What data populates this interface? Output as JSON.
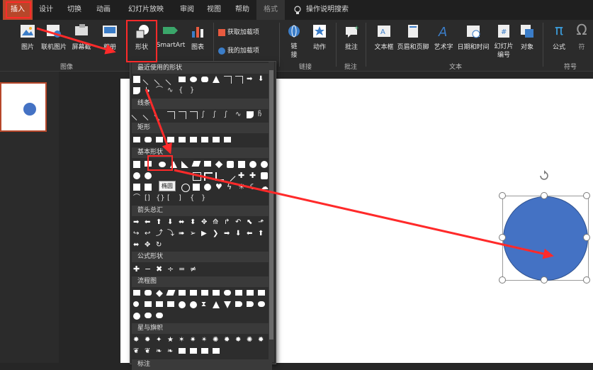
{
  "tabs": [
    "插入",
    "设计",
    "切换",
    "动画",
    "幻灯片放映",
    "审阅",
    "视图",
    "帮助",
    "格式",
    "操作说明搜索"
  ],
  "ribbon": {
    "image_btn": "图片",
    "online_image_btn": "联机图片",
    "screenshot_btn": "屏幕截",
    "album_btn": "相册",
    "shapes_btn": "形状",
    "smartart_btn": "SmartArt",
    "chart_btn": "图表",
    "get_addins": "获取加载项",
    "my_addins": "我的加载项",
    "link_btn_1": "链",
    "link_btn_2": "接",
    "action_btn": "动作",
    "comment_btn": "批注",
    "textbox_btn": "文本框",
    "headerfooter_btn": "页眉和页脚",
    "wordart_btn": "艺术字",
    "datetime_btn": "日期和时间",
    "slidenum_btn_1": "幻灯片",
    "slidenum_btn_2": "编号",
    "object_btn": "对象",
    "equation_btn": "公式",
    "symbol_btn": "符",
    "groups": {
      "image": "图像",
      "link": "链接",
      "comment": "批注",
      "text": "文本",
      "symbol": "符号"
    }
  },
  "shapes_menu": {
    "recent": "最近使用的形状",
    "lines": "线条",
    "rect": "矩形",
    "basic": "基本形状",
    "arrows": "箭头总汇",
    "equation": "公式形状",
    "flow": "流程图",
    "stars": "星与旗帜",
    "tooltip": "椭圆",
    "last": "标注"
  },
  "colors": {
    "accent": "#b7472a",
    "shape_fill": "#4472c4",
    "annotation": "#ff2a2a"
  }
}
